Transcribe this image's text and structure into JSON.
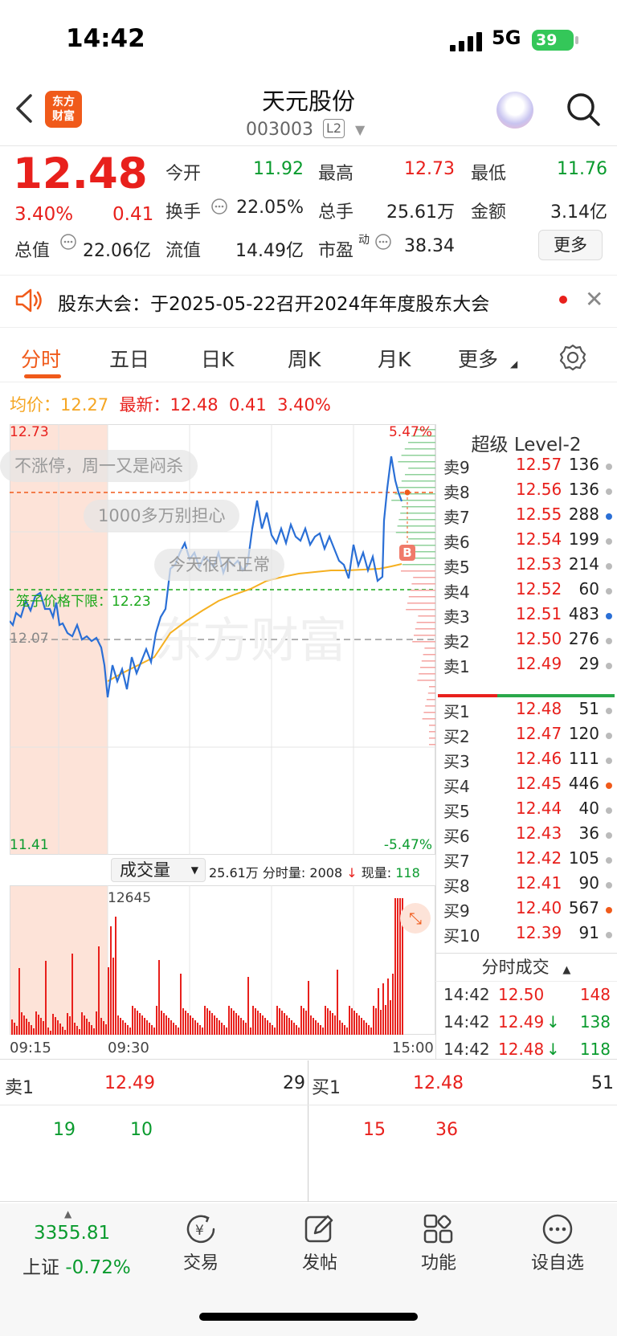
{
  "status": {
    "time": "14:42",
    "network": "5G",
    "battery": "39"
  },
  "header": {
    "back_icon": "chevron-left-icon",
    "logo": "东方\n财富",
    "stock_name": "天元股份",
    "stock_code": "003003",
    "level_badge": "L2"
  },
  "quote": {
    "price": "12.48",
    "change_pct": "3.40%",
    "change_amt": "0.41",
    "open_label": "今开",
    "open": "11.92",
    "high_label": "最高",
    "high": "12.73",
    "low_label": "最低",
    "low": "11.76",
    "turnover_label": "换手",
    "turnover": "22.05%",
    "total_hands_label": "总手",
    "total_hands": "25.61万",
    "amount_label": "金额",
    "amount": "3.14亿",
    "mktcap_label": "总值",
    "mktcap": "22.06亿",
    "float_label": "流值",
    "float_cap": "14.49亿",
    "pe_label": "市盈",
    "pe_sup": "动",
    "pe": "38.34",
    "more": "更多"
  },
  "notice": {
    "text": "股东大会：于2025-05-22召开2024年年度股东大会"
  },
  "tabs": [
    {
      "label": "分时"
    },
    {
      "label": "五日"
    },
    {
      "label": "日K"
    },
    {
      "label": "周K"
    },
    {
      "label": "月K"
    },
    {
      "label": "更多"
    }
  ],
  "avg_row": {
    "avg_label": "均价：",
    "avg": "12.27",
    "latest_label": "最新：",
    "latest": "12.48",
    "chg": "0.41",
    "pct": "3.40%"
  },
  "chart": {
    "top_price": "12.73",
    "bottom_price": "11.41",
    "top_pct": "5.47%",
    "bottom_pct": "-5.47%",
    "prev_close": "12.07",
    "cage_label": "笼子价格下限：",
    "cage_value": "12.23",
    "b_marker": "B",
    "watermark": "东方财富",
    "danmu": [
      "不涨停，周一又是闷杀",
      "1000多万别担心",
      "今天很不正常"
    ]
  },
  "volume": {
    "selector": "成交量",
    "total": "25.61万",
    "minute_label": "分时量:",
    "minute": "2008",
    "now_label": "现量:",
    "now": "118",
    "max_label": "12645"
  },
  "time_axis": [
    "09:15",
    "09:30",
    "15:00"
  ],
  "level2": {
    "title": "超级 Level-2",
    "asks": [
      {
        "label": "卖9",
        "price": "12.57",
        "vol": "136",
        "dot": "#bbbbbb"
      },
      {
        "label": "卖8",
        "price": "12.56",
        "vol": "136",
        "dot": "#bbbbbb"
      },
      {
        "label": "卖7",
        "price": "12.55",
        "vol": "288",
        "dot": "#2a6fd6"
      },
      {
        "label": "卖6",
        "price": "12.54",
        "vol": "199",
        "dot": "#bbbbbb"
      },
      {
        "label": "卖5",
        "price": "12.53",
        "vol": "214",
        "dot": "#bbbbbb"
      },
      {
        "label": "卖4",
        "price": "12.52",
        "vol": "60",
        "dot": "#bbbbbb"
      },
      {
        "label": "卖3",
        "price": "12.51",
        "vol": "483",
        "dot": "#2a6fd6"
      },
      {
        "label": "卖2",
        "price": "12.50",
        "vol": "276",
        "dot": "#bbbbbb"
      },
      {
        "label": "卖1",
        "price": "12.49",
        "vol": "29",
        "dot": "#bbbbbb"
      }
    ],
    "bids": [
      {
        "label": "买1",
        "price": "12.48",
        "vol": "51",
        "dot": "#bbbbbb"
      },
      {
        "label": "买2",
        "price": "12.47",
        "vol": "120",
        "dot": "#bbbbbb"
      },
      {
        "label": "买3",
        "price": "12.46",
        "vol": "111",
        "dot": "#bbbbbb"
      },
      {
        "label": "买4",
        "price": "12.45",
        "vol": "446",
        "dot": "#f05a1a"
      },
      {
        "label": "买5",
        "price": "12.44",
        "vol": "40",
        "dot": "#bbbbbb"
      },
      {
        "label": "买6",
        "price": "12.43",
        "vol": "36",
        "dot": "#bbbbbb"
      },
      {
        "label": "买7",
        "price": "12.42",
        "vol": "105",
        "dot": "#bbbbbb"
      },
      {
        "label": "买8",
        "price": "12.41",
        "vol": "90",
        "dot": "#bbbbbb"
      },
      {
        "label": "买9",
        "price": "12.40",
        "vol": "567",
        "dot": "#f05a1a"
      },
      {
        "label": "买10",
        "price": "12.39",
        "vol": "91",
        "dot": "#bbbbbb"
      }
    ]
  },
  "ticks": {
    "title": "分时成交",
    "rows": [
      {
        "time": "14:42",
        "price": "12.50",
        "arrow": "",
        "vol": "148",
        "vcolor": "red"
      },
      {
        "time": "14:42",
        "price": "12.49",
        "arrow": "↓",
        "vol": "138",
        "vcolor": "green"
      },
      {
        "time": "14:42",
        "price": "12.48",
        "arrow": "↓",
        "vol": "118",
        "vcolor": "green"
      }
    ]
  },
  "bottom_quote": {
    "sell_label": "卖1",
    "sell_price": "12.49",
    "sell_vol": "29",
    "buy_label": "买1",
    "buy_price": "12.48",
    "buy_vol": "51",
    "sell_q1": "19",
    "sell_q2": "10",
    "buy_q1": "15",
    "buy_q2": "36"
  },
  "nav": {
    "index_value": "3355.81",
    "index_label": "上证",
    "index_pct": "-0.72%",
    "trade": "交易",
    "post": "发帖",
    "function": "功能",
    "watchlist": "设自选"
  }
}
